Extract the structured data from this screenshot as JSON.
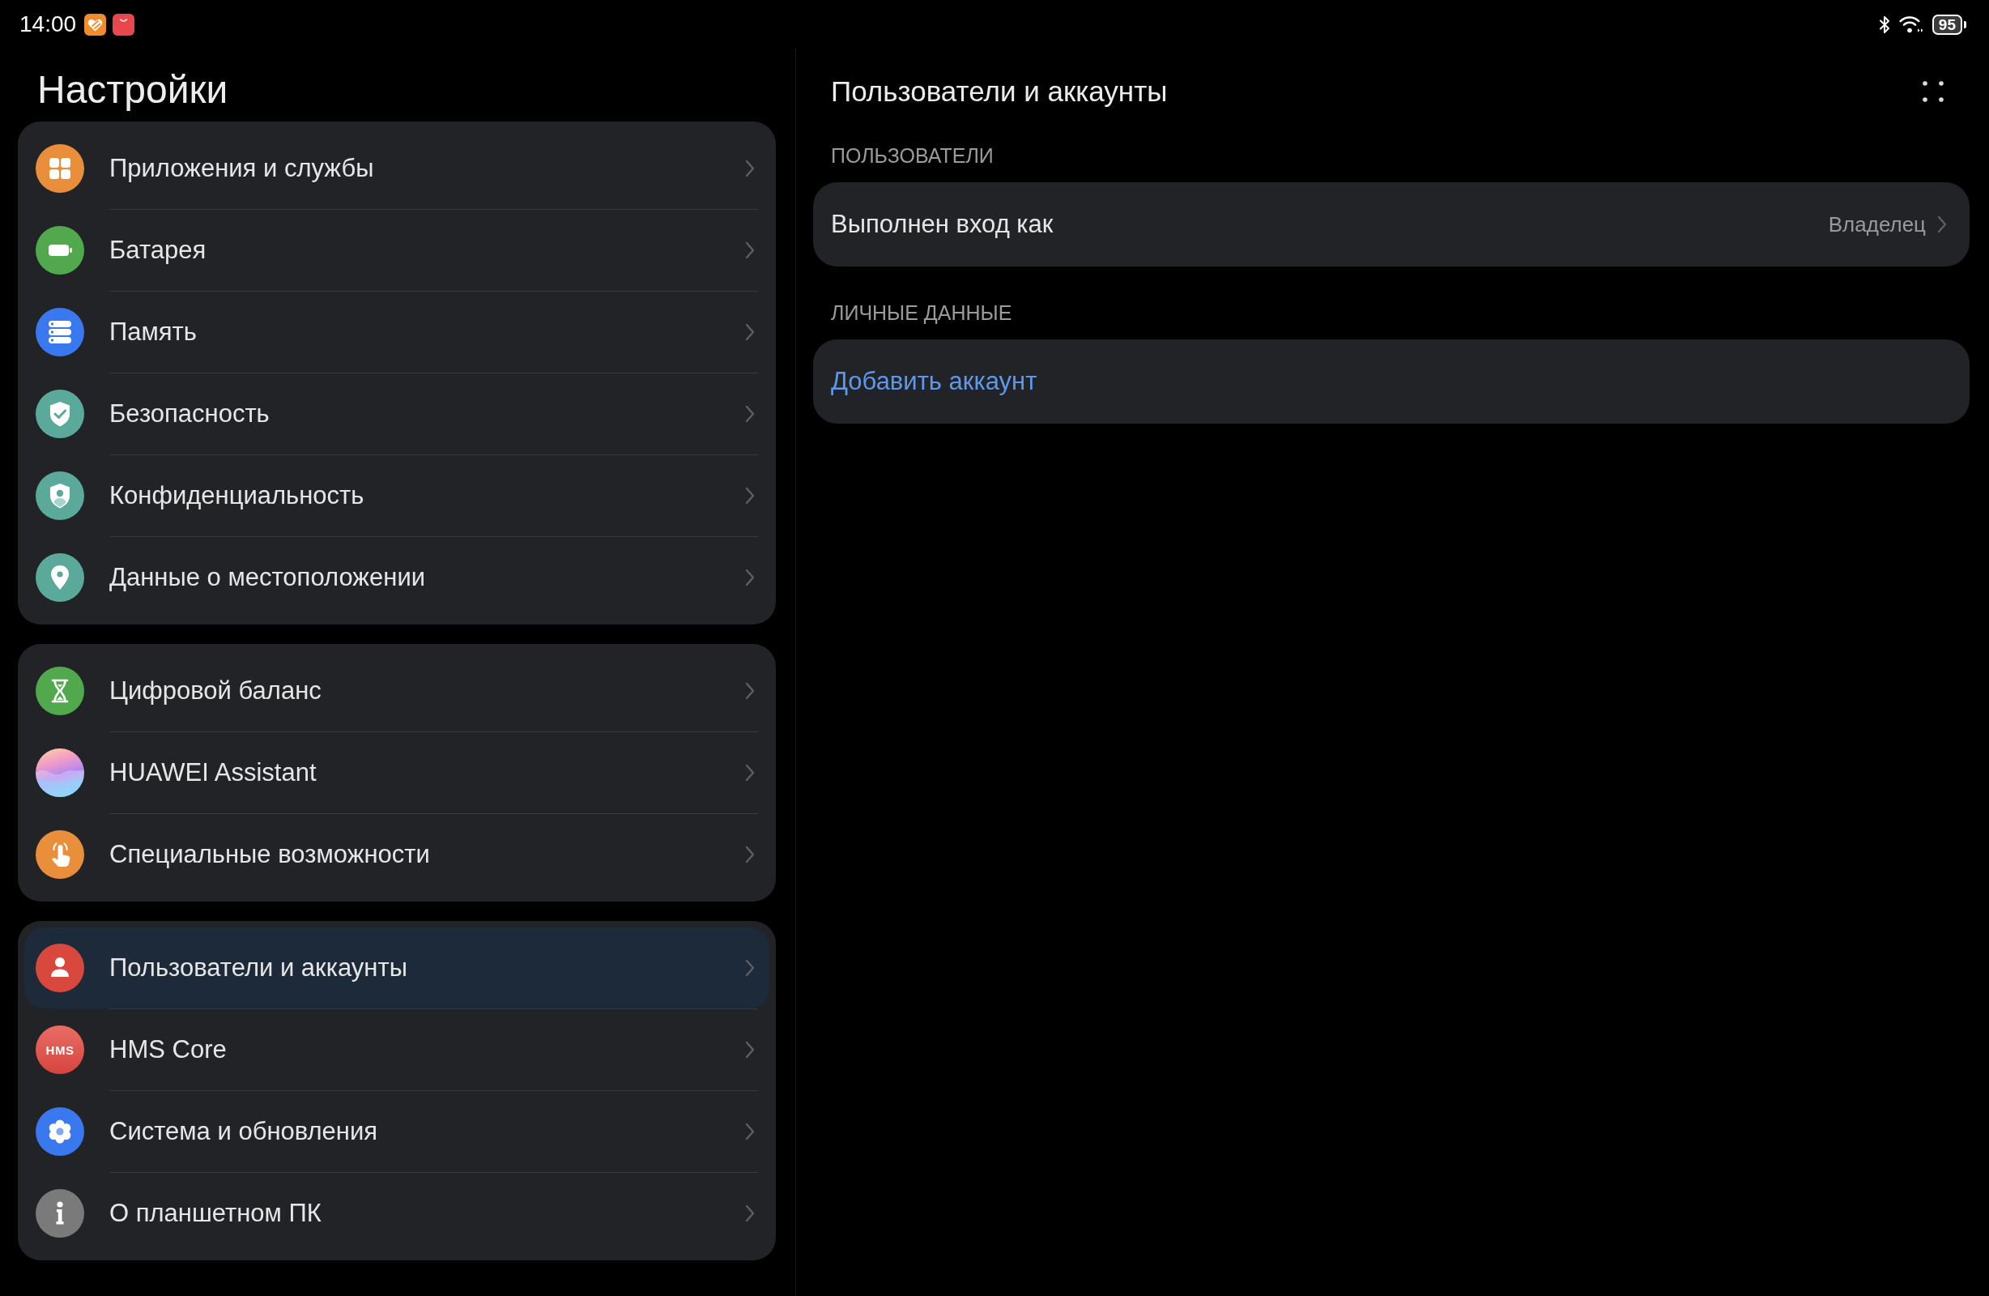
{
  "status_bar": {
    "time": "14:00",
    "battery": "95"
  },
  "sidebar": {
    "title": "Настройки",
    "groups": [
      {
        "items": [
          {
            "label": "Приложения и службы",
            "kind": "apps",
            "selected": false
          },
          {
            "label": "Батарея",
            "kind": "battery",
            "selected": false
          },
          {
            "label": "Память",
            "kind": "storage",
            "selected": false
          },
          {
            "label": "Безопасность",
            "kind": "security",
            "selected": false
          },
          {
            "label": "Конфиденциальность",
            "kind": "privacy",
            "selected": false
          },
          {
            "label": "Данные о местоположении",
            "kind": "location",
            "selected": false
          }
        ]
      },
      {
        "items": [
          {
            "label": "Цифровой баланс",
            "kind": "wellbeing",
            "selected": false
          },
          {
            "label": "HUAWEI Assistant",
            "kind": "assistant",
            "selected": false
          },
          {
            "label": "Специальные возможности",
            "kind": "accessibility",
            "selected": false
          }
        ]
      },
      {
        "items": [
          {
            "label": "Пользователи и аккаунты",
            "kind": "users",
            "selected": true
          },
          {
            "label": "HMS Core",
            "kind": "hms",
            "icon_text": "HMS",
            "selected": false
          },
          {
            "label": "Система и обновления",
            "kind": "system",
            "selected": false
          },
          {
            "label": "О планшетном ПК",
            "kind": "about",
            "selected": false
          }
        ]
      }
    ]
  },
  "detail": {
    "title": "Пользователи и аккаунты",
    "sections": [
      {
        "header": "ПОЛЬЗОВАТЕЛИ",
        "rows": [
          {
            "kind": "value",
            "label": "Выполнен вход как",
            "value": "Владелец"
          }
        ]
      },
      {
        "header": "ЛИЧНЫЕ ДАННЫЕ",
        "rows": [
          {
            "kind": "link",
            "label": "Добавить аккаунт"
          }
        ]
      }
    ]
  }
}
